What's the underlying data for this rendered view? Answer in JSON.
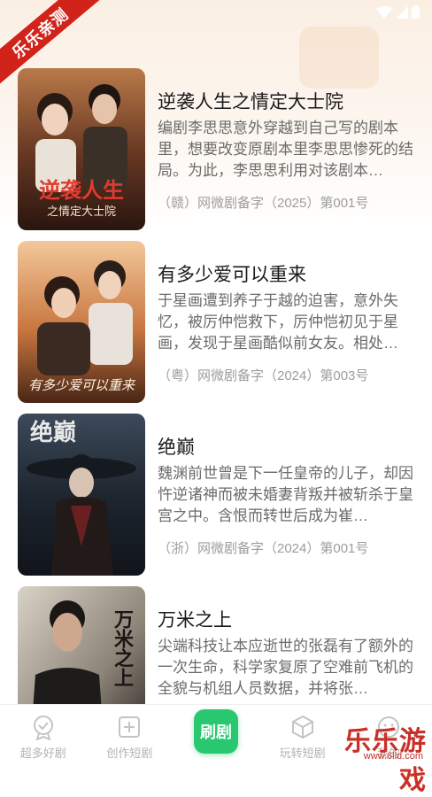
{
  "badge": "乐乐亲测",
  "dramas": [
    {
      "title": "逆袭人生之情定大士院",
      "desc": "编剧李思思意外穿越到自己写的剧本里，想要改变原剧本里李思思惨死的结局。为此，李思思利用对该剧本…",
      "license": "（赣）网微剧备字（2025）第001号",
      "poster_text": "逆袭人生",
      "poster_sub": "之情定大士院"
    },
    {
      "title": "有多少爱可以重来",
      "desc": "于星画遭到养子于越的迫害，意外失忆，被厉仲恺救下，厉仲恺初见于星画，发现于星画酷似前女友。相处…",
      "license": "（粤）网微剧备字（2024）第003号",
      "poster_text": "有多少爱可以重来"
    },
    {
      "title": "绝巅",
      "desc": "魏渊前世曾是下一任皇帝的儿子，却因忤逆诸神而被未婚妻背叛并被斩杀于皇宫之中。含恨而转世后成为崔…",
      "license": "（浙）网微剧备字（2024）第001号",
      "poster_text": "绝巅"
    },
    {
      "title": "万米之上",
      "desc": "尖端科技让本应逝世的张磊有了额外的一次生命，科学家复原了空难前飞机的全貌与机组人员数据，并将张…",
      "license": "",
      "poster_text": "万米之上"
    }
  ],
  "tabs": {
    "t1": "超多好剧",
    "t2": "创作短剧",
    "center": "刷剧",
    "t4": "玩转短剧",
    "t5": "我的"
  },
  "watermark": {
    "main": "乐乐游戏",
    "sub": "www.6lld.com"
  }
}
